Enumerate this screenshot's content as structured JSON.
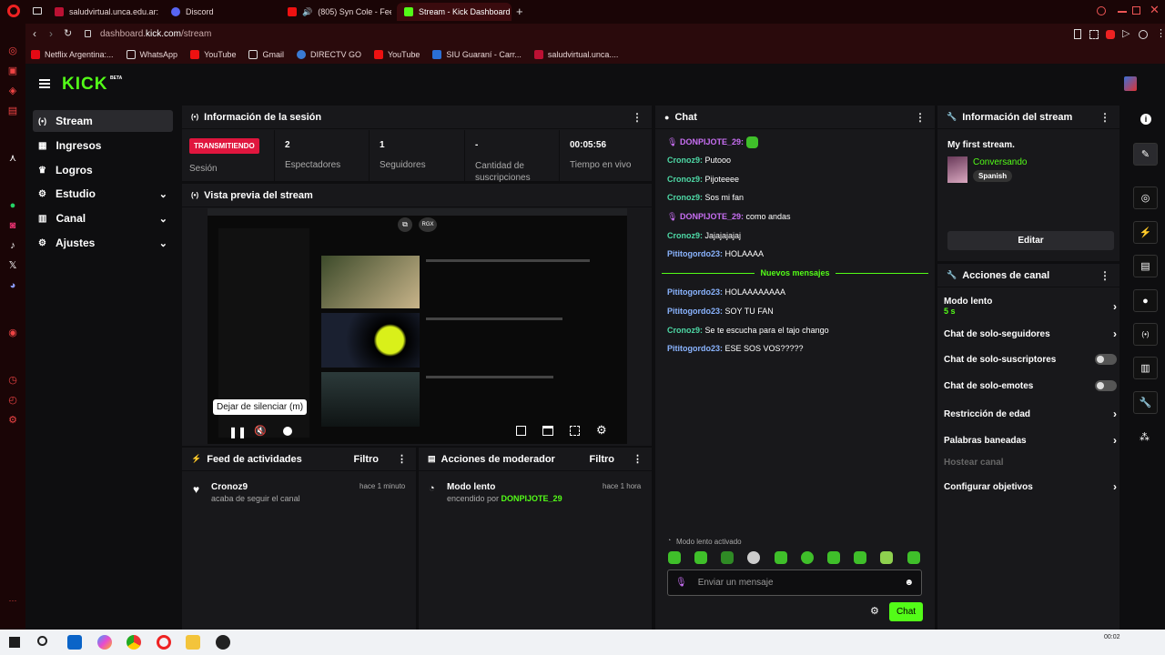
{
  "browser": {
    "tabs": [
      {
        "label": "saludvirtual.unca.edu.ar: ",
        "color": "#b13"
      },
      {
        "label": "Discord",
        "color": "#5865f2"
      },
      {
        "label": "(805) Syn Cole - Feel",
        "color": "#e11"
      },
      {
        "label": "Stream - Kick Dashboard",
        "color": "#53fc18"
      }
    ],
    "new_tab": "+",
    "url_domain": "dashboard.",
    "url_host": "kick.com",
    "url_path": "/stream",
    "bookmarks": [
      "Netflix Argentina:...",
      "WhatsApp",
      "YouTube",
      "Gmail",
      "DIRECTV GO",
      "YouTube",
      "SIU Guaraní - Carr...",
      "saludvirtual.unca...."
    ]
  },
  "app": {
    "logo": "KICK",
    "logo_badge": "BETA",
    "nav": [
      {
        "label": "Stream",
        "active": true
      },
      {
        "label": "Ingresos"
      },
      {
        "label": "Logros"
      },
      {
        "label": "Estudio",
        "chevron": true
      },
      {
        "label": "Canal",
        "chevron": true
      },
      {
        "label": "Ajustes",
        "chevron": true
      }
    ],
    "session": {
      "title": "Información de la sesión",
      "status_badge": "TRANSMITIENDO",
      "status_label": "Sesión",
      "stats": [
        {
          "value": "2",
          "label": "Espectadores"
        },
        {
          "value": "1",
          "label": "Seguidores"
        },
        {
          "value": "-",
          "label": "Cantidad de suscripciones"
        },
        {
          "value": "00:05:56",
          "label": "Tiempo en vivo"
        }
      ]
    },
    "preview": {
      "title": "Vista previa del stream",
      "tooltip": "Dejar de silenciar (m)",
      "rgx_badge": "RGX"
    },
    "feed": {
      "title": "Feed de actividades",
      "filter": "Filtro",
      "item_user": "Cronoz9",
      "item_text": "acaba de seguir el canal",
      "item_time": "hace 1 minuto"
    },
    "mod": {
      "title": "Acciones de moderador",
      "filter": "Filtro",
      "item_title": "Modo lento",
      "item_text": "encendido por ",
      "item_user": "DONPIJOTE_29",
      "item_time": "hace 1 hora"
    },
    "chat": {
      "title": "Chat",
      "messages": [
        {
          "user": "DONPIJOTE_29",
          "text": ""
        },
        {
          "user": "Cronoz9",
          "text": "Putooo"
        },
        {
          "user": "Cronoz9",
          "text": "Pijoteeee"
        },
        {
          "user": "Cronoz9",
          "text": "Sos mi fan"
        },
        {
          "user": "DONPIJOTE_29",
          "text": "como andas"
        },
        {
          "user": "Cronoz9",
          "text": "Jajajajajaj"
        },
        {
          "user": "Pititogordo23",
          "text": "HOLAAAA"
        },
        {
          "user": "Pititogordo23",
          "text": "HOLAAAAAAAA"
        },
        {
          "user": "Pititogordo23",
          "text": "SOY TU FAN"
        },
        {
          "user": "Cronoz9",
          "text": "Se te escucha para el tajo chango"
        },
        {
          "user": "Pititogordo23",
          "text": "ESE SOS VOS?????"
        }
      ],
      "new_messages": "Nuevos mensajes",
      "slow_mode_note": "Modo lento activado",
      "input_placeholder": "Enviar un mensaje",
      "send_button": "Chat"
    },
    "stream_info": {
      "title": "Información del stream",
      "stream_title": "My first stream.",
      "category": "Conversando",
      "language": "Spanish",
      "edit_button": "Editar"
    },
    "channel_actions": {
      "title": "Acciones de canal",
      "slow_mode": "Modo lento",
      "slow_mode_value": "5 s",
      "followers_only": "Chat de solo-seguidores",
      "subs_only": "Chat de solo-suscriptores",
      "emotes_only": "Chat de solo-emotes",
      "age_restriction": "Restricción de edad",
      "banned_words": "Palabras baneadas",
      "host_channel": "Hostear canal",
      "goals": "Configurar objetivos"
    }
  },
  "taskbar": {
    "time": "00:02"
  }
}
